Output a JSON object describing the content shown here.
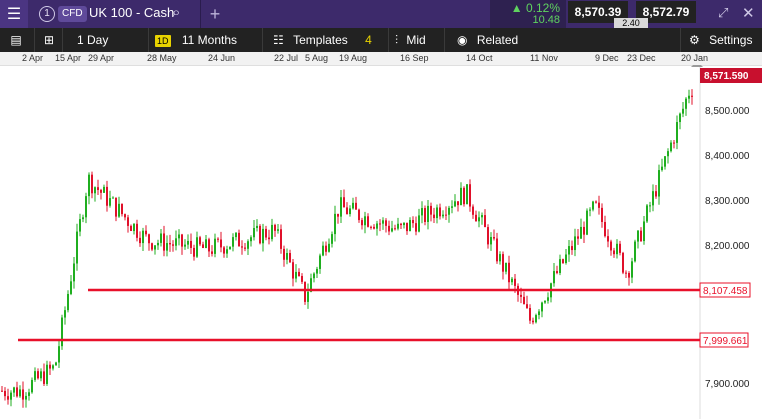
{
  "header": {
    "menu_icon": "hamburger-menu-icon",
    "tab_number": "1",
    "instrument_type": "CFD",
    "instrument_name": "UK 100 - Cash",
    "search_icon": "search-icon",
    "add_icon": "plus-icon",
    "change_percent": "▲ 0.12%",
    "change_points": "10.48",
    "bid": "8,570.39",
    "offer": "8,572.79",
    "spread": "2.40",
    "expand_icon": "expand-icon",
    "close_icon": "close-icon"
  },
  "toolbar": {
    "list_icon": "list-icon",
    "layout_icon": "layout-icon",
    "interval_label": "1 Day",
    "interval_badge": "1D",
    "range_label": "11 Months",
    "templates_label": "Templates",
    "templates_count": "4",
    "price_type_label": "Mid",
    "related_label": "Related",
    "settings_label": "Settings",
    "candles_icon": "candlestick-icon",
    "eye_icon": "eye-icon",
    "settings_icon": "gear-icon"
  },
  "date_axis": [
    "2 Apr",
    "15 Apr",
    "29 Apr",
    "28 May",
    "24 Jun",
    "22 Jul",
    "5 Aug",
    "19 Aug",
    "16 Sep",
    "14 Oct",
    "11 Nov",
    "9 Dec",
    "23 Dec",
    "20 Jan"
  ],
  "price_axis": [
    "8,500.000",
    "8,400.000",
    "8,300.000",
    "8,200.000",
    "7,900.000"
  ],
  "last_price_label": "8,571.590",
  "horizontal_lines": [
    {
      "label": "8,107.458",
      "value": 8107.458
    },
    {
      "label": "7,999.661",
      "value": 7999.661
    }
  ],
  "colors": {
    "up": "#1fae1f",
    "down": "#e0102a",
    "line": "#e8102a",
    "header_bg": "#3d2a6b",
    "toolbar_bg": "#222222"
  },
  "chart_data": {
    "type": "line",
    "series": [
      {
        "x": [
          "2 Apr",
          "15 Apr",
          "29 Apr",
          "28 May",
          "24 Jun",
          "22 Jul",
          "5 Aug",
          "19 Aug",
          "16 Sep",
          "14 Oct",
          "11 Nov",
          "9 Dec",
          "23 Dec",
          "20 Jan"
        ],
        "y": [
          7930,
          7980,
          8380,
          8250,
          8230,
          8270,
          8130,
          8320,
          8270,
          8350,
          8080,
          8320,
          8180,
          8571.59
        ]
      }
    ],
    "ylim": [
      7870,
      8600
    ]
  }
}
